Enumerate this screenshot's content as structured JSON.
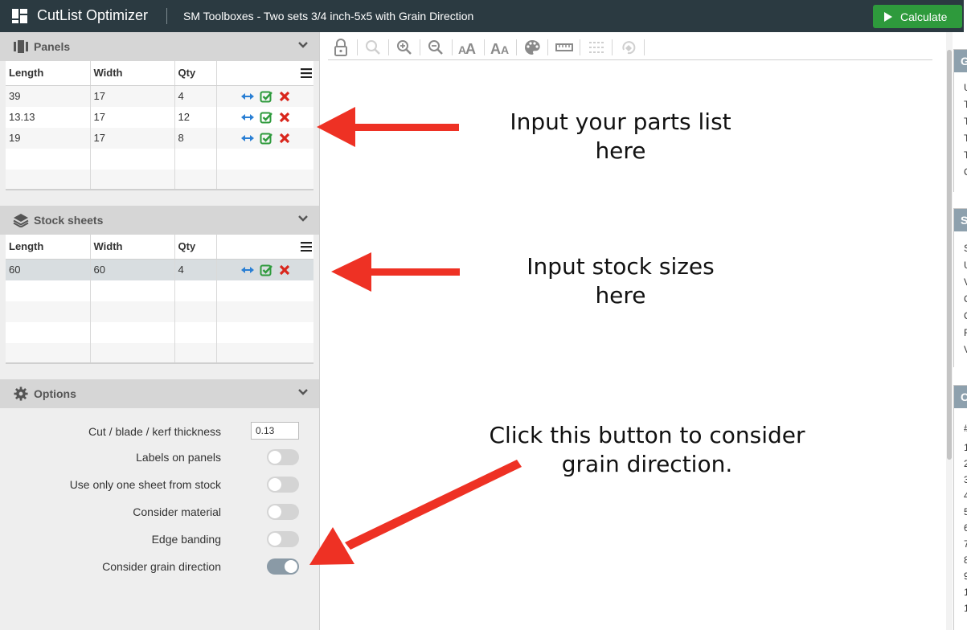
{
  "header": {
    "app_title": "CutList Optimizer",
    "project_title": "SM Toolboxes - Two sets 3/4 inch-5x5 with Grain Direction",
    "calculate_label": "Calculate"
  },
  "panels": {
    "title": "Panels",
    "columns": [
      "Length",
      "Width",
      "Qty"
    ],
    "rows": [
      {
        "length": "39",
        "width": "17",
        "qty": "4"
      },
      {
        "length": "13.13",
        "width": "17",
        "qty": "12"
      },
      {
        "length": "19",
        "width": "17",
        "qty": "8"
      },
      {
        "length": "",
        "width": "",
        "qty": ""
      },
      {
        "length": "",
        "width": "",
        "qty": ""
      }
    ]
  },
  "stock": {
    "title": "Stock sheets",
    "columns": [
      "Length",
      "Width",
      "Qty"
    ],
    "rows": [
      {
        "length": "60",
        "width": "60",
        "qty": "4"
      },
      {
        "length": "",
        "width": "",
        "qty": ""
      },
      {
        "length": "",
        "width": "",
        "qty": ""
      },
      {
        "length": "",
        "width": "",
        "qty": ""
      },
      {
        "length": "",
        "width": "",
        "qty": ""
      }
    ]
  },
  "options": {
    "title": "Options",
    "kerf_label": "Cut / blade / kerf thickness",
    "kerf_value": "0.13",
    "toggles": [
      {
        "label": "Labels on panels",
        "on": false
      },
      {
        "label": "Use only one sheet from stock",
        "on": false
      },
      {
        "label": "Consider material",
        "on": false
      },
      {
        "label": "Edge banding",
        "on": false
      },
      {
        "label": "Consider grain direction",
        "on": true
      }
    ]
  },
  "annotations": {
    "parts": "Input your parts list here",
    "stock": "Input stock sizes here",
    "grain_line1": "Click this button to consider",
    "grain_line2": "grain direction."
  },
  "right_panel": {
    "card1_head": "G",
    "card1_lines": [
      "U",
      "T",
      "T",
      "T",
      "T",
      "C"
    ],
    "card2_head": "S",
    "card2_lines": [
      "S",
      "U",
      "V",
      "C",
      "C",
      "F",
      "V"
    ],
    "card3_head": "C",
    "card3_lines": [
      "#",
      "1",
      "2",
      "3",
      "4",
      "5",
      "6",
      "7",
      "8",
      "9",
      "1",
      "1"
    ]
  },
  "colors": {
    "topbar": "#2b3a41",
    "calculate_green": "#2e9a3c",
    "arrow_red": "#ee3124",
    "swap_blue": "#2a7fd4",
    "check_green": "#2e9a3c",
    "delete_red": "#d9261c"
  }
}
